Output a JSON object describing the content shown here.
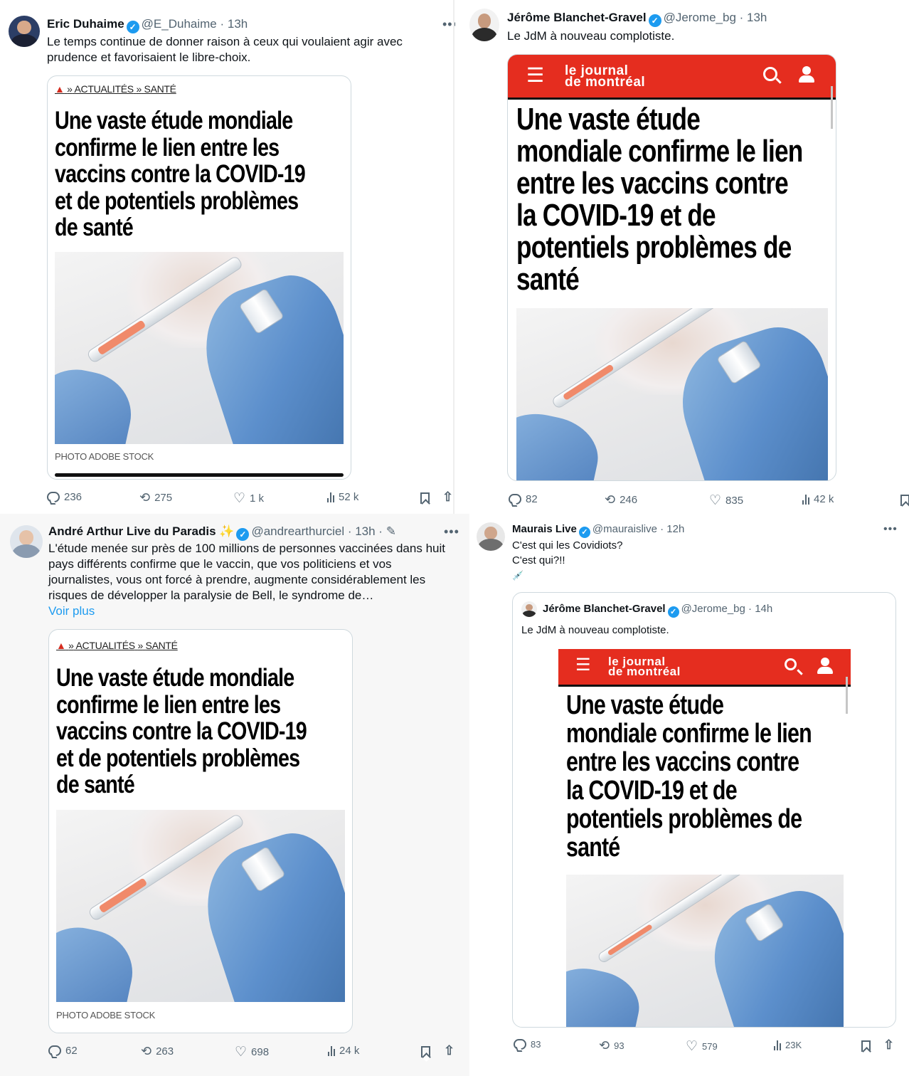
{
  "tweets": [
    {
      "author_name": "Eric Duhaime",
      "handle": "@E_Duhaime",
      "time": "· 13h",
      "text_line1": "Le temps continue de donner raison à ceux qui voulaient agir avec",
      "text_line2": "prudence et favorisaient le libre-choix.",
      "card": {
        "crumb_home": "⌂",
        "crumb_sep": "»",
        "crumb_1": "ACTUALITÉS",
        "crumb_2": "SANTÉ",
        "headline_lines": [
          "Une vaste étude mondiale",
          "confirme le lien entre les",
          "vaccins contre la COVID-19",
          "et de potentiels problèmes",
          "de santé"
        ],
        "caption": "PHOTO ADOBE STOCK"
      },
      "stats": {
        "replies": "236",
        "retweets": "275",
        "likes": "1 k",
        "views": "52 k"
      }
    },
    {
      "author_name": "Jérôme Blanchet-Gravel",
      "handle": "@Jerome_bg",
      "time": "· 13h",
      "text_line1": "Le JdM à nouveau complotiste.",
      "card": {
        "logo_line1": "le journal",
        "logo_line2": "de montréal",
        "headline_lines": [
          "Une vaste étude",
          "mondiale confirme le lien",
          "entre les vaccins contre",
          "la COVID-19 et de",
          "potentiels problèmes de",
          "santé"
        ]
      },
      "stats": {
        "replies": "82",
        "retweets": "246",
        "likes": "835",
        "views": "42 k"
      }
    },
    {
      "author_name": "André Arthur Live du Paradis",
      "emoji": "✨",
      "handle": "@andrearthurciel",
      "time": "· 13h ·",
      "edit_icon": "✎",
      "text_lines": [
        "L'étude menée sur près de 100 millions de personnes vaccinées dans huit",
        "pays différents confirme que le vaccin, que vos politiciens et vos",
        "journalistes, vous ont forcé à prendre, augmente considérablement les",
        "risques de développer la paralysie de Bell, le syndrome de…"
      ],
      "show_more": "Voir plus",
      "card": {
        "crumb_home": "⌂",
        "crumb_sep": "»",
        "crumb_1": "ACTUALITÉS",
        "crumb_2": "SANTÉ",
        "headline_lines": [
          "Une vaste étude mondiale",
          "confirme le lien entre les",
          "vaccins contre la COVID-19",
          "et de potentiels problèmes",
          "de santé"
        ],
        "caption": "PHOTO ADOBE STOCK"
      },
      "stats": {
        "replies": "62",
        "retweets": "263",
        "likes": "698",
        "views": "24 k"
      }
    },
    {
      "author_name": "Maurais Live",
      "handle": "@mauraislive",
      "time": "· 12h",
      "text_line1": "C'est qui les Covidiots?",
      "text_line2": "C'est qui?!!",
      "emoji": "💉",
      "quoted": {
        "author_name": "Jérôme Blanchet-Gravel",
        "handle": "@Jerome_bg",
        "time": "· 14h",
        "text": "Le JdM à nouveau complotiste.",
        "logo_line1": "le journal",
        "logo_line2": "de montréal",
        "headline_lines": [
          "Une vaste étude",
          "mondiale confirme le lien",
          "entre les vaccins contre",
          "la COVID-19 et de",
          "potentiels problèmes de",
          "santé"
        ]
      },
      "stats": {
        "replies": "83",
        "retweets": "93",
        "likes": "579",
        "views": "23K"
      }
    }
  ],
  "icons": {
    "more": "•••",
    "verified": "✓",
    "retweet": "⟲",
    "like": "♡",
    "share": "⇧",
    "menu": "☰"
  },
  "colors": {
    "verified_blue": "#1d9bf0",
    "jdm_red": "#e52d1f",
    "muted": "#536471"
  }
}
